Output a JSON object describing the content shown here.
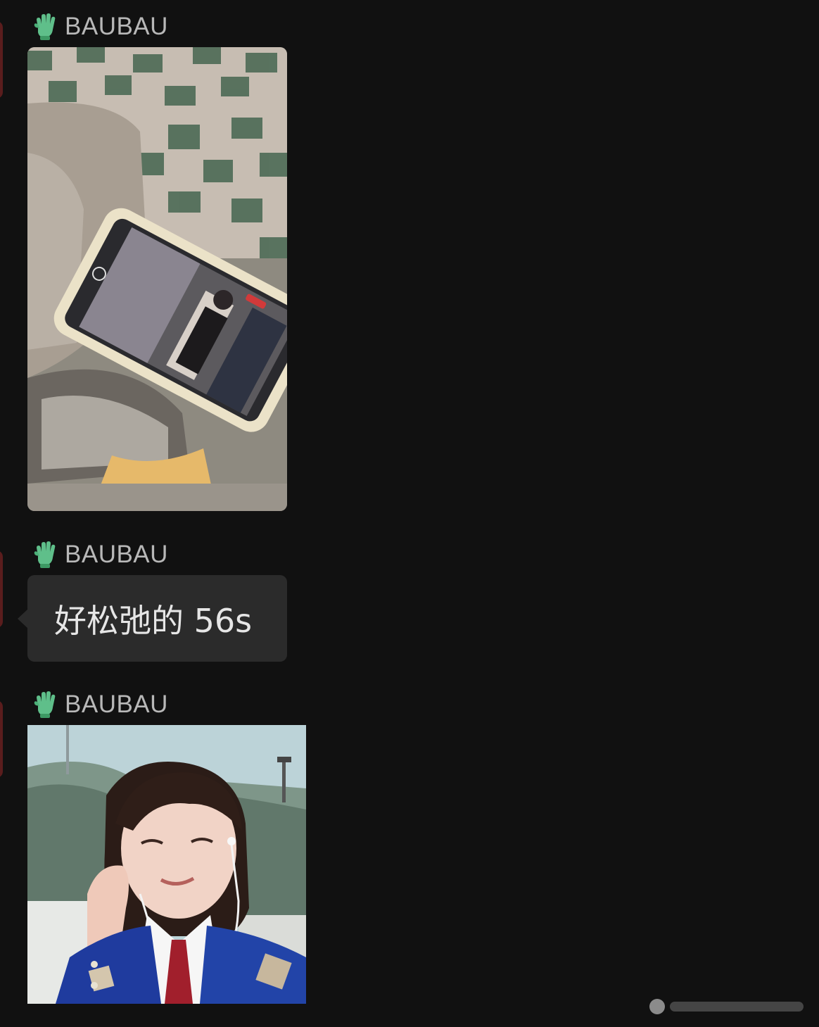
{
  "messages": [
    {
      "sender": "BAUBAU",
      "type": "image",
      "icon": "green-glove-icon",
      "content": "photo-phone-on-table"
    },
    {
      "sender": "BAUBAU",
      "type": "text",
      "icon": "green-glove-icon",
      "text": "好松弛的 56s"
    },
    {
      "sender": "BAUBAU",
      "type": "image",
      "icon": "green-glove-icon",
      "content": "photo-girl-with-earphones"
    }
  ],
  "colors": {
    "background": "#111111",
    "bubble": "#2b2b2b",
    "sender_name": "#b8b8b8",
    "bubble_text": "#e6e6e6",
    "glove": "#5fbf8a"
  }
}
